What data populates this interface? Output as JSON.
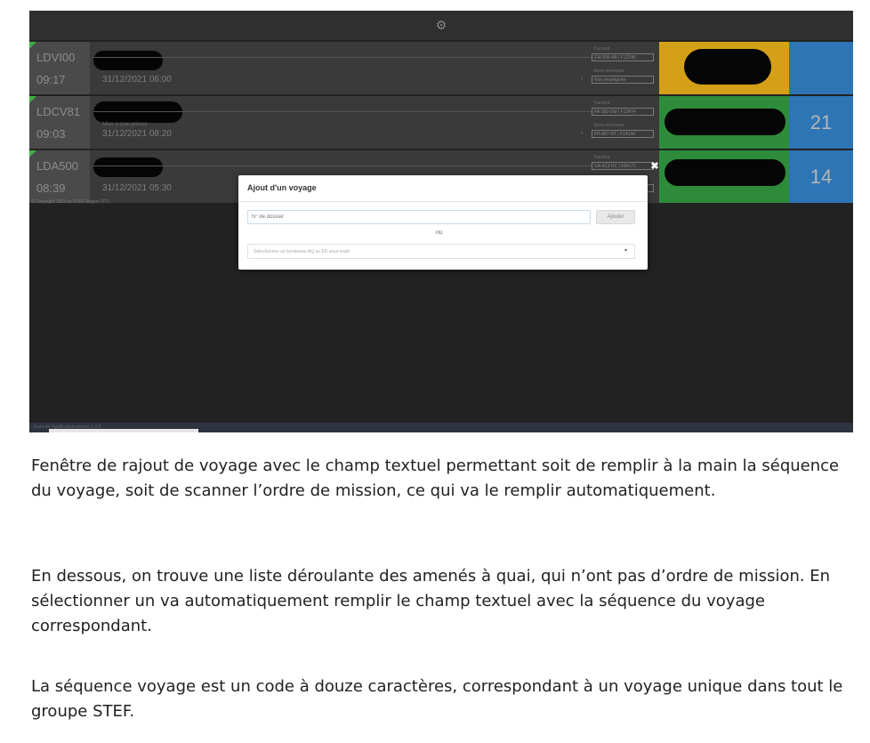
{
  "screenshot": {
    "rows": [
      {
        "code": "LDVI00",
        "time": "09:17",
        "sublabel": "",
        "date": "31/12/2021 06:00",
        "field1_label": "Tracteur",
        "field1_value": "EM-390-AB | F12345",
        "field2_label": "Semi-remorque",
        "field2_value": "Non renseignée",
        "counter": "",
        "panel_color": "#d4a017"
      },
      {
        "code": "LDCV81",
        "time": "09:03",
        "sublabel": "Mise à quai prévue",
        "date": "31/12/2021 08:20",
        "field1_label": "Tracteur",
        "field1_value": "FA-390-DM | F13474",
        "field2_label": "Semi-remorque",
        "field2_value": "FH-807-NT | F24144",
        "counter": "21",
        "panel_color": "#2e8b3a"
      },
      {
        "code": "LDA500",
        "time": "08:39",
        "sublabel": "",
        "date": "31/12/2021 05:30",
        "field1_label": "Tracteur",
        "field1_value": "GA-413-HC | F84171",
        "field2_label": "",
        "field2_value": "",
        "counter": "14",
        "panel_color": "#2e8b3a"
      }
    ],
    "copyright": "© Copyright 2021 by STEF Region DT1",
    "bottom_text": "Jours de l'application version 1.0.0",
    "colors": {
      "counter_blue": "#2e75b6",
      "flag_green": "#3cb043"
    }
  },
  "modal": {
    "title": "Ajout d'un voyage",
    "dossier_placeholder": "N° de dossier",
    "add_label": "Ajouter",
    "or_label": "OU",
    "select_placeholder": "Sélectionnez un bordereau AQ ou ED sous-traité",
    "close_glyph": "✖",
    "caret_glyph": "▾"
  },
  "caption": {
    "p1": "Fenêtre de rajout de voyage avec le champ textuel permettant soit de remplir à la main la séquence du voyage, soit de scanner l’ordre de mission, ce qui va le remplir automatiquement.",
    "p2": "En dessous, on trouve une liste déroulante des amenés à quai, qui n’ont pas d’ordre de mission. En sélectionner un va automatiquement remplir le champ textuel avec la séquence du voyage correspondant.",
    "p3": "La séquence voyage est un code à douze caractères, correspondant à un voyage unique dans tout le groupe STEF."
  },
  "icons": {
    "settings": "gear-icon",
    "close": "close-icon",
    "dropdown": "chevron-down-icon",
    "arrow": "chevron-right-icon"
  }
}
